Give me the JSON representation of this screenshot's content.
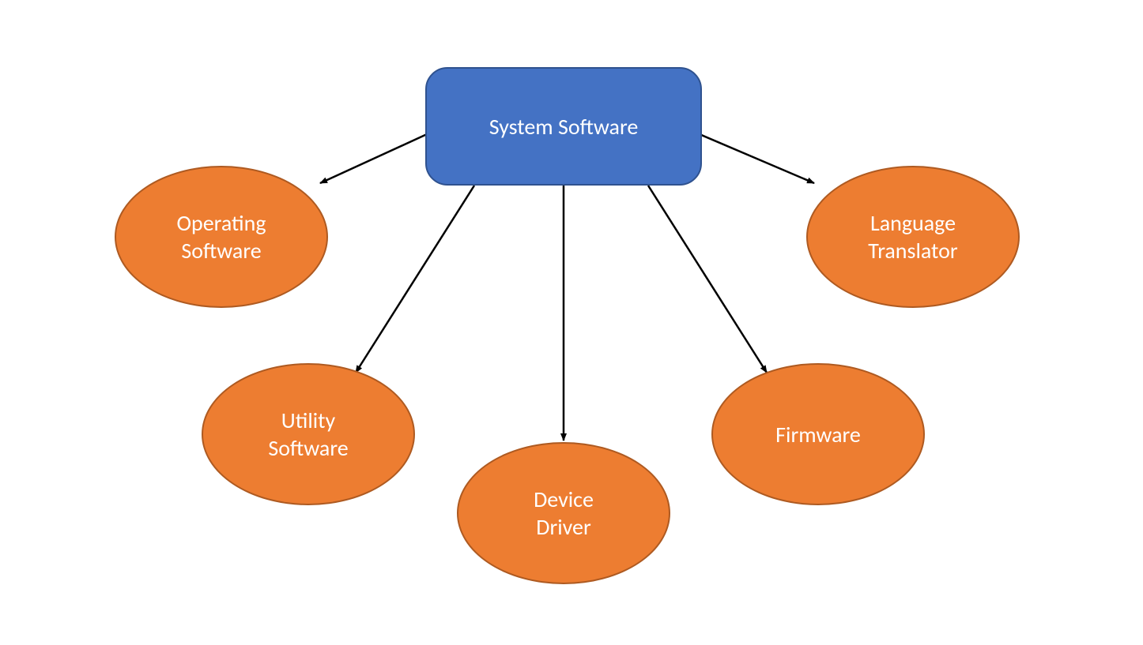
{
  "diagram": {
    "root": {
      "label": "System Software"
    },
    "children": [
      {
        "id": "operating",
        "label_line1": "Operating",
        "label_line2": "Software"
      },
      {
        "id": "utility",
        "label_line1": "Utility",
        "label_line2": "Software"
      },
      {
        "id": "device",
        "label_line1": "Device",
        "label_line2": "Driver"
      },
      {
        "id": "firmware",
        "label_line1": "Firmware",
        "label_line2": ""
      },
      {
        "id": "language",
        "label_line1": "Language",
        "label_line2": "Translator"
      }
    ]
  }
}
